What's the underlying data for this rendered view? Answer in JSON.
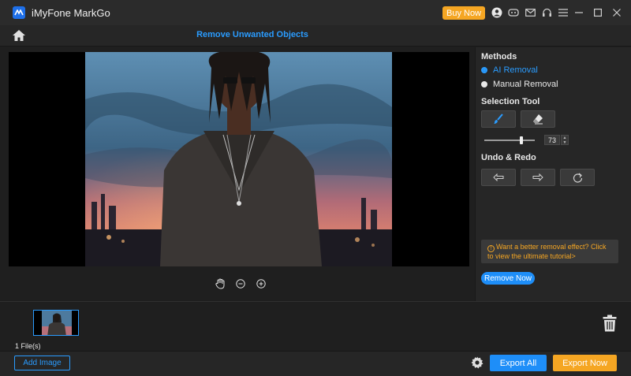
{
  "app": {
    "title": "iMyFone MarkGo",
    "buy_label": "Buy Now",
    "accent": "#1e8ef8",
    "orange": "#f5a623",
    "titlebar_icons": [
      "user-icon",
      "discord-icon",
      "mail-icon",
      "headset-icon",
      "menu-icon"
    ],
    "window_controls": [
      "minimize-icon",
      "maximize-icon",
      "close-icon"
    ]
  },
  "header": {
    "page_title": "Remove Unwanted Objects"
  },
  "canvas": {
    "tools": [
      "hand-icon",
      "zoom-out-icon",
      "zoom-in-icon"
    ]
  },
  "panel": {
    "methods_title": "Methods",
    "methods": [
      {
        "label": "AI Removal",
        "selected": true
      },
      {
        "label": "Manual Removal",
        "selected": false
      }
    ],
    "selection_title": "Selection Tool",
    "brush_size": "73",
    "brush_fraction": 0.73,
    "undo_title": "Undo & Redo",
    "tip": "Want a better removal effect? Click to view the ultimate tutorial>",
    "remove_label": "Remove Now"
  },
  "files": {
    "count_label": "1 File(s)"
  },
  "bottom": {
    "add_label": "Add Image",
    "export_all_label": "Export All",
    "export_now_label": "Export Now"
  }
}
